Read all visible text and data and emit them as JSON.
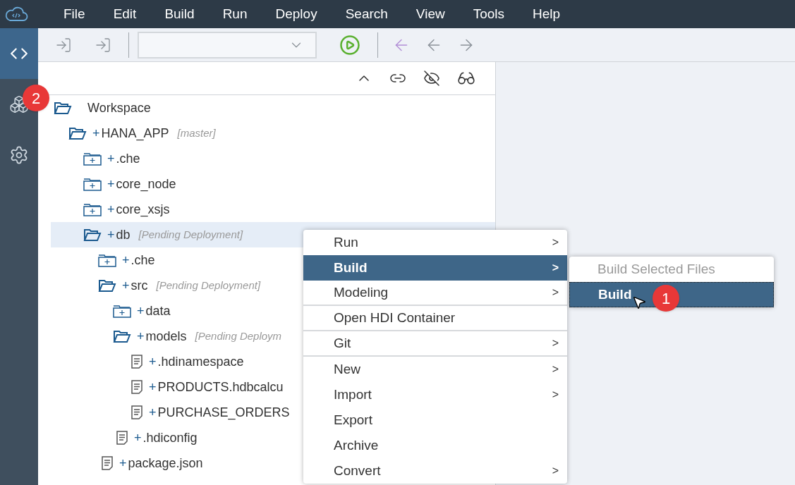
{
  "menubar": {
    "items": [
      "File",
      "Edit",
      "Build",
      "Run",
      "Deploy",
      "Search",
      "View",
      "Tools",
      "Help"
    ]
  },
  "rail": {
    "items": [
      {
        "kind": "code",
        "selected": true
      },
      {
        "kind": "cubes",
        "selected": false,
        "badge": "2"
      },
      {
        "kind": "settings",
        "selected": false
      }
    ]
  },
  "tree": [
    {
      "label": "Workspace",
      "kind": "folder",
      "expanded": true,
      "selected": false,
      "children": [
        {
          "label": "HANA_APP",
          "prefix": "+",
          "note": "[master]",
          "kind": "folder",
          "expanded": true,
          "selected": false,
          "children": [
            {
              "label": ".che",
              "prefix": "+",
              "kind": "folder",
              "expanded": false,
              "selected": false
            },
            {
              "label": "core_node",
              "prefix": "+",
              "kind": "folder",
              "expanded": false,
              "selected": false
            },
            {
              "label": "core_xsjs",
              "prefix": "+",
              "kind": "folder",
              "expanded": false,
              "selected": false
            },
            {
              "label": "db",
              "prefix": "+",
              "note": "[Pending Deployment]",
              "kind": "folder",
              "expanded": true,
              "selected": true,
              "children": [
                {
                  "label": ".che",
                  "prefix": "+",
                  "kind": "folder",
                  "expanded": false,
                  "selected": false
                },
                {
                  "label": "src",
                  "prefix": "+",
                  "note": "[Pending Deployment]",
                  "kind": "folder",
                  "expanded": true,
                  "selected": false,
                  "children": [
                    {
                      "label": "data",
                      "prefix": "+",
                      "kind": "folder",
                      "expanded": false,
                      "selected": false
                    },
                    {
                      "label": "models",
                      "prefix": "+",
                      "note": "[Pending Deploym",
                      "kind": "folder",
                      "expanded": true,
                      "selected": false,
                      "children": [
                        {
                          "label": ".hdinamespace",
                          "prefix": "+",
                          "kind": "file",
                          "selected": false
                        },
                        {
                          "label": "PRODUCTS.hdbcalcu",
                          "prefix": "+",
                          "kind": "file",
                          "selected": false
                        },
                        {
                          "label": "PURCHASE_ORDERS",
                          "prefix": "+",
                          "kind": "file",
                          "selected": false
                        }
                      ]
                    },
                    {
                      "label": ".hdiconfig",
                      "prefix": "+",
                      "kind": "file",
                      "selected": false
                    }
                  ]
                },
                {
                  "label": "package.json",
                  "prefix": "+",
                  "kind": "file",
                  "selected": false
                }
              ]
            }
          ]
        }
      ]
    }
  ],
  "context_menu": {
    "items": [
      {
        "label": "Run",
        "submenu": true,
        "selected": false,
        "divider_after": false
      },
      {
        "label": "Build",
        "submenu": true,
        "selected": true,
        "divider_after": false
      },
      {
        "label": "Modeling",
        "submenu": true,
        "selected": false,
        "divider_after": true
      },
      {
        "label": "Open HDI Container",
        "submenu": false,
        "selected": false,
        "divider_after": true
      },
      {
        "label": "Git",
        "submenu": true,
        "selected": false,
        "divider_after": true
      },
      {
        "label": "New",
        "submenu": true,
        "selected": false,
        "divider_after": false
      },
      {
        "label": "Import",
        "submenu": true,
        "selected": false,
        "divider_after": false
      },
      {
        "label": "Export",
        "submenu": false,
        "selected": false,
        "divider_after": false
      },
      {
        "label": "Archive",
        "submenu": false,
        "selected": false,
        "divider_after": false
      },
      {
        "label": "Convert",
        "submenu": true,
        "selected": false,
        "divider_after": false
      }
    ],
    "arrow": ">"
  },
  "submenu": {
    "items": [
      {
        "label": "Build Selected Files",
        "disabled": true,
        "selected": false
      },
      {
        "label": "Build",
        "disabled": false,
        "selected": true,
        "badge": "1"
      }
    ]
  }
}
